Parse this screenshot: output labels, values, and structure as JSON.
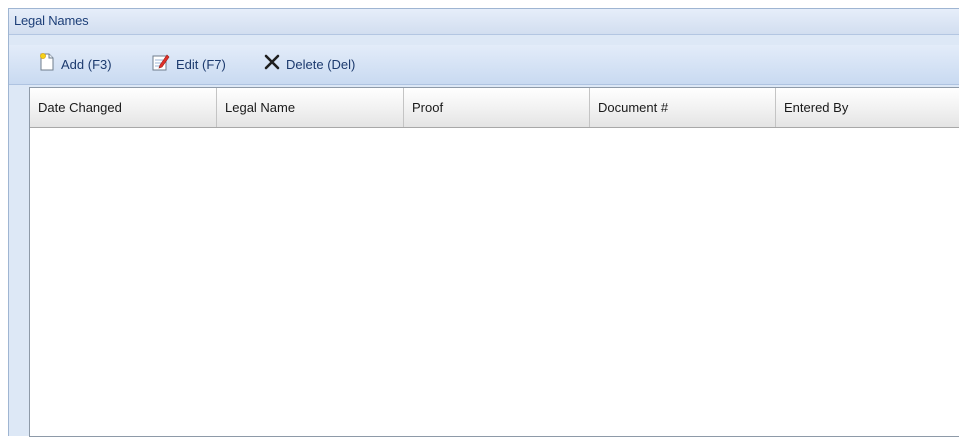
{
  "panel": {
    "title": "Legal Names"
  },
  "toolbar": {
    "add_label": "Add (F3)",
    "edit_label": "Edit (F7)",
    "delete_label": "Delete (Del)"
  },
  "grid": {
    "columns": [
      "Date Changed",
      "Legal Name",
      "Proof",
      "Document #",
      "Entered By"
    ],
    "rows": []
  },
  "icons": {
    "add": "new-document-icon",
    "edit": "edit-document-icon",
    "delete": "delete-x-icon"
  }
}
